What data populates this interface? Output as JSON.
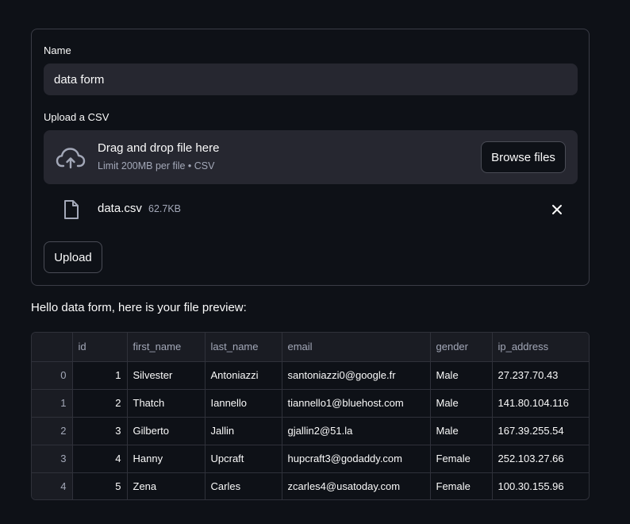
{
  "form": {
    "name_label": "Name",
    "name_value": "data form",
    "upload_label": "Upload a CSV",
    "dropzone": {
      "title": "Drag and drop file here",
      "subtitle": "Limit 200MB per file • CSV",
      "browse_label": "Browse files",
      "icon": "cloud-upload-icon"
    },
    "file": {
      "name": "data.csv",
      "size": "62.7KB",
      "icon": "file-icon"
    },
    "submit_label": "Upload"
  },
  "preview_text": "Hello data form, here is your file preview:",
  "table": {
    "columns": [
      "",
      "id",
      "first_name",
      "last_name",
      "email",
      "gender",
      "ip_address"
    ],
    "rows": [
      [
        "0",
        "1",
        "Silvester",
        "Antoniazzi",
        "santoniazzi0@google.fr",
        "Male",
        "27.237.70.43"
      ],
      [
        "1",
        "2",
        "Thatch",
        "Iannello",
        "tiannello1@bluehost.com",
        "Male",
        "141.80.104.116"
      ],
      [
        "2",
        "3",
        "Gilberto",
        "Jallin",
        "gjallin2@51.la",
        "Male",
        "167.39.255.54"
      ],
      [
        "3",
        "4",
        "Hanny",
        "Upcraft",
        "hupcraft3@godaddy.com",
        "Female",
        "252.103.27.66"
      ],
      [
        "4",
        "5",
        "Zena",
        "Carles",
        "zcarles4@usatoday.com",
        "Female",
        "100.30.155.96"
      ]
    ]
  },
  "colors": {
    "background": "#0e1117",
    "input_bg": "#262730",
    "border": "#3a3c46",
    "muted_text": "#a3a8b8",
    "text": "#fafafa"
  }
}
